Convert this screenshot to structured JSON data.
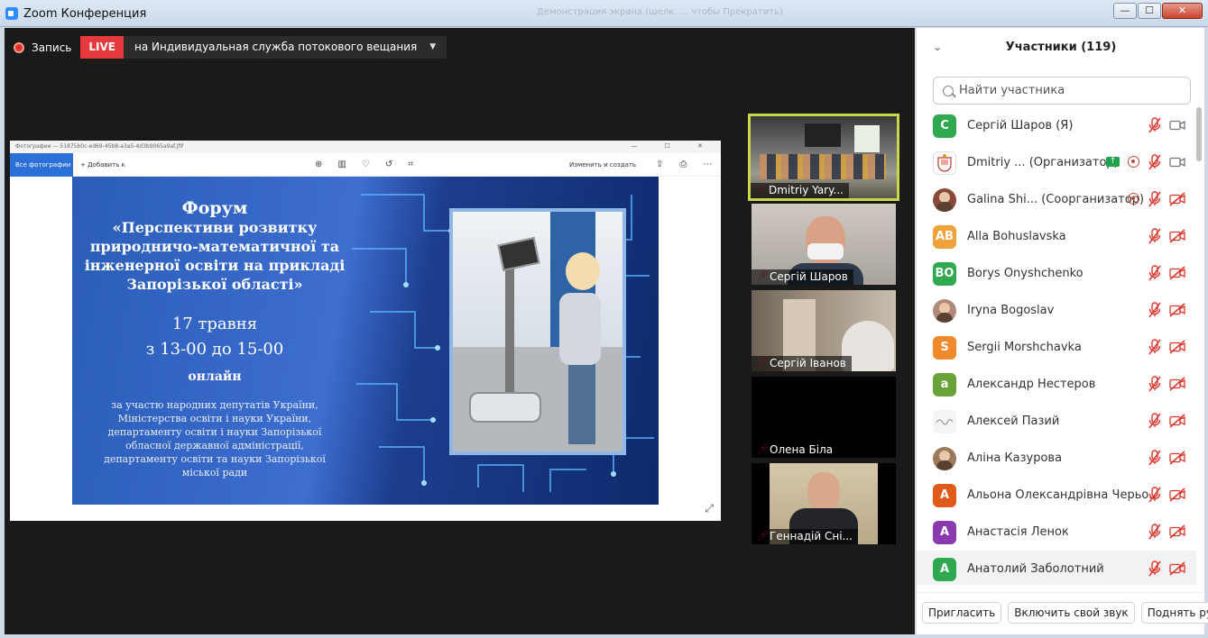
{
  "window": {
    "title": "Zoom Конференция",
    "ghost_title": "Демонстрация экрана (щелк. ... чтобы Прекратить)",
    "min": "—",
    "max": "☐",
    "close": "✕"
  },
  "recording": {
    "record_label": "Запись",
    "live_label": "LIVE",
    "stream_target": "на Индивидуальная служба потокового вещания",
    "stream_caret": "▼"
  },
  "viewer": {
    "title": "Фотографии — 51875b0c-ed69-45b8-a3a5-4d3b9065a9af.jfif",
    "all_photos": "Все фотографии",
    "add_to": "+ Добавить к",
    "edit_create": "Изменить и создать",
    "slide": {
      "heading": "Форум",
      "topic_lines": [
        "«Перспективи розвитку",
        "природничо-математичної та",
        "інженерної освіти на прикладі",
        "Запорізької області»"
      ],
      "date": "17 травня",
      "time": "з 13-00 до 15-00",
      "mode": "онлайн",
      "desc_lines": [
        "за участю народних депутатів України,",
        "Міністерства освіти і науки України,",
        "департаменту освіти і науки Запорізької",
        "обласної державної адміністрації,",
        "департаменту освіти та науки Запорізької",
        "міської ради"
      ]
    }
  },
  "thumbnails": [
    {
      "name": "Dmitriy Yary...",
      "active": true
    },
    {
      "name": "Сергій Шаров",
      "active": false
    },
    {
      "name": "Сергій Іванов",
      "active": false
    },
    {
      "name": "Олена Біла",
      "active": false
    },
    {
      "name": "Геннадій Сні...",
      "active": false
    }
  ],
  "panel": {
    "title": "Участники (119)",
    "search_placeholder": "Найти участника",
    "participants": [
      {
        "initials": "С",
        "color": "#2fa84f",
        "name": "Сергій Шаров (Я)",
        "mic_muted": true,
        "video_off": false
      },
      {
        "initials": "",
        "color": "#ffffff",
        "name": "Dmitriy ... (Организатор)",
        "sharing": true,
        "recording": true,
        "mic_muted": true,
        "video_off": false
      },
      {
        "initials": "",
        "color": "#8a4a3a",
        "name": "Galina Shi... (Соорганизатор)",
        "recording": true,
        "mic_muted": true,
        "video_off": true
      },
      {
        "initials": "AB",
        "color": "#f0a23a",
        "name": "Alla Bohuslavska",
        "mic_muted": true,
        "video_off": true
      },
      {
        "initials": "BO",
        "color": "#2fa84f",
        "name": "Borys Onyshchenko",
        "mic_muted": true,
        "video_off": true
      },
      {
        "initials": "",
        "color": "#b08a7a",
        "name": "Iryna Bogoslav",
        "mic_muted": true,
        "video_off": true
      },
      {
        "initials": "S",
        "color": "#f0892a",
        "name": "Sergii Morshchavka",
        "mic_muted": true,
        "video_off": true
      },
      {
        "initials": "а",
        "color": "#6aa33a",
        "name": "Александр Нестеров",
        "mic_muted": true,
        "video_off": true
      },
      {
        "initials": "",
        "color": "#f4f4f4",
        "name": "Алексей Пазий",
        "mic_muted": true,
        "video_off": true
      },
      {
        "initials": "",
        "color": "#9a7a5a",
        "name": "Аліна Казурова",
        "mic_muted": true,
        "video_off": true
      },
      {
        "initials": "А",
        "color": "#e05a1a",
        "name": "Альона Олександрівна Черьо...",
        "mic_muted": true,
        "video_off": true
      },
      {
        "initials": "А",
        "color": "#8a3ab0",
        "name": "Анастасія Ленок",
        "mic_muted": true,
        "video_off": true
      },
      {
        "initials": "А",
        "color": "#2fa84f",
        "name": "Анатолий Заболотний",
        "mic_muted": true,
        "video_off": true,
        "highlight": true
      }
    ],
    "buttons": {
      "invite": "Пригласить",
      "unmute": "Включить свой звук",
      "raise_hand": "Поднять руку"
    }
  },
  "colors": {
    "live_red": "#e5393b",
    "active_speaker": "#c7d94a",
    "muted_red": "#e0352b",
    "zoom_blue": "#2d8cff"
  },
  "icons": {
    "collapse": "chevron-down-icon",
    "search": "search-icon",
    "mic": "mic-muted-icon",
    "video": "video-icon",
    "expand": "expand-icon"
  }
}
